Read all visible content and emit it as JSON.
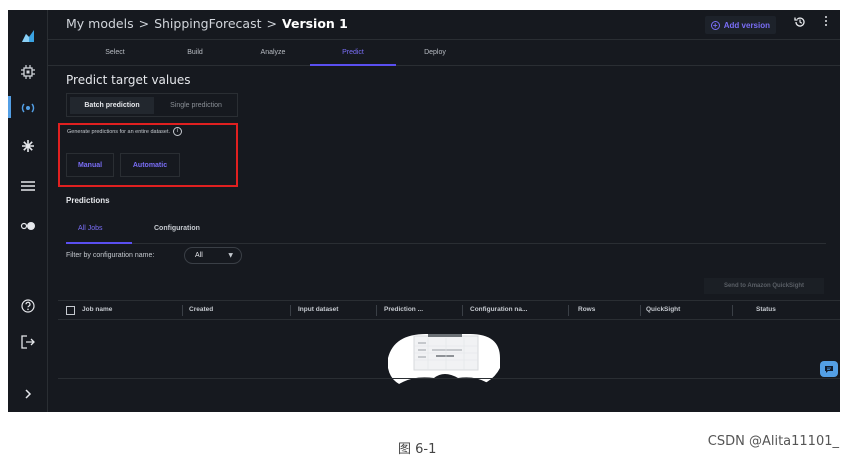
{
  "breadcrumb": {
    "items": [
      "My models",
      "ShippingForecast"
    ],
    "separator": ">",
    "current": "Version 1"
  },
  "header": {
    "add_version_label": "Add version",
    "history_icon": "history-icon",
    "more_icon": "more-icon"
  },
  "tabs": [
    "Select",
    "Build",
    "Analyze",
    "Predict",
    "Deploy"
  ],
  "active_tab": "Predict",
  "page_title": "Predict target values",
  "prediction_tabs": {
    "batch": "Batch prediction",
    "single": "Single prediction"
  },
  "generate_text": "Generate predictions for an entire dataset.",
  "info_glyph": "i",
  "buttons": {
    "manual": "Manual",
    "automatic": "Automatic"
  },
  "predictions": {
    "title": "Predictions",
    "tabs": {
      "all_jobs": "All Jobs",
      "configuration": "Configuration"
    },
    "filter_label": "Filter by configuration name:",
    "filter_value": "All",
    "send_button": "Send to Amazon QuickSight",
    "columns": [
      "Job name",
      "Created",
      "Input dataset",
      "Prediction ...",
      "Configuration na...",
      "Rows",
      "QuickSight",
      "Status"
    ]
  },
  "sidebar_icons": [
    "canvas-logo-icon",
    "chip-icon",
    "ready-to-use-models-icon",
    "ml-ops-icon",
    "datasets-icon",
    "toggle-icon",
    "help-icon",
    "logout-icon",
    "expand-icon"
  ],
  "caption": "图 6-1",
  "watermark": "CSDN @Alita11101_",
  "colors": {
    "background": "#16191f",
    "accent": "#7a6ef7",
    "highlight_box": "#e02020",
    "sidebar_active": "#539fe5"
  }
}
